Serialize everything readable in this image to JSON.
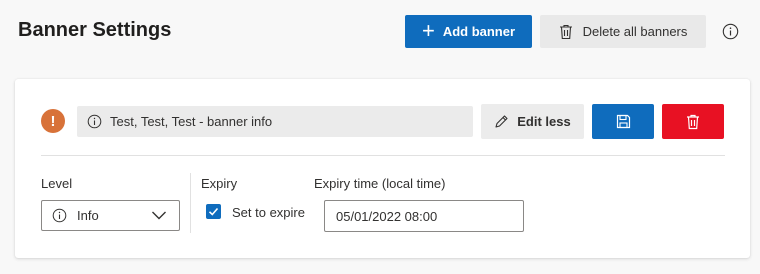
{
  "header": {
    "title": "Banner Settings",
    "add_label": "Add banner",
    "delete_all_label": "Delete all banners"
  },
  "banner": {
    "message": "Test, Test, Test - banner info",
    "edit_label": "Edit less",
    "level_label": "Level",
    "level_value": "Info",
    "expiry_label": "Expiry",
    "set_to_expire_label": "Set to expire",
    "set_to_expire_checked": true,
    "expiry_time_label": "Expiry time (local time)",
    "expiry_time_value": "05/01/2022 08:00"
  },
  "icons": {
    "add": "plus-icon",
    "delete_all": "trash-icon",
    "help": "info-icon",
    "warning": "exclamation-icon",
    "message": "info-icon",
    "edit": "pencil-icon",
    "save": "save-icon",
    "delete": "trash-icon",
    "level": "info-icon",
    "dropdown": "chevron-down-icon"
  },
  "colors": {
    "primary": "#0f6cbd",
    "danger": "#e81123",
    "warning": "#d87239"
  }
}
